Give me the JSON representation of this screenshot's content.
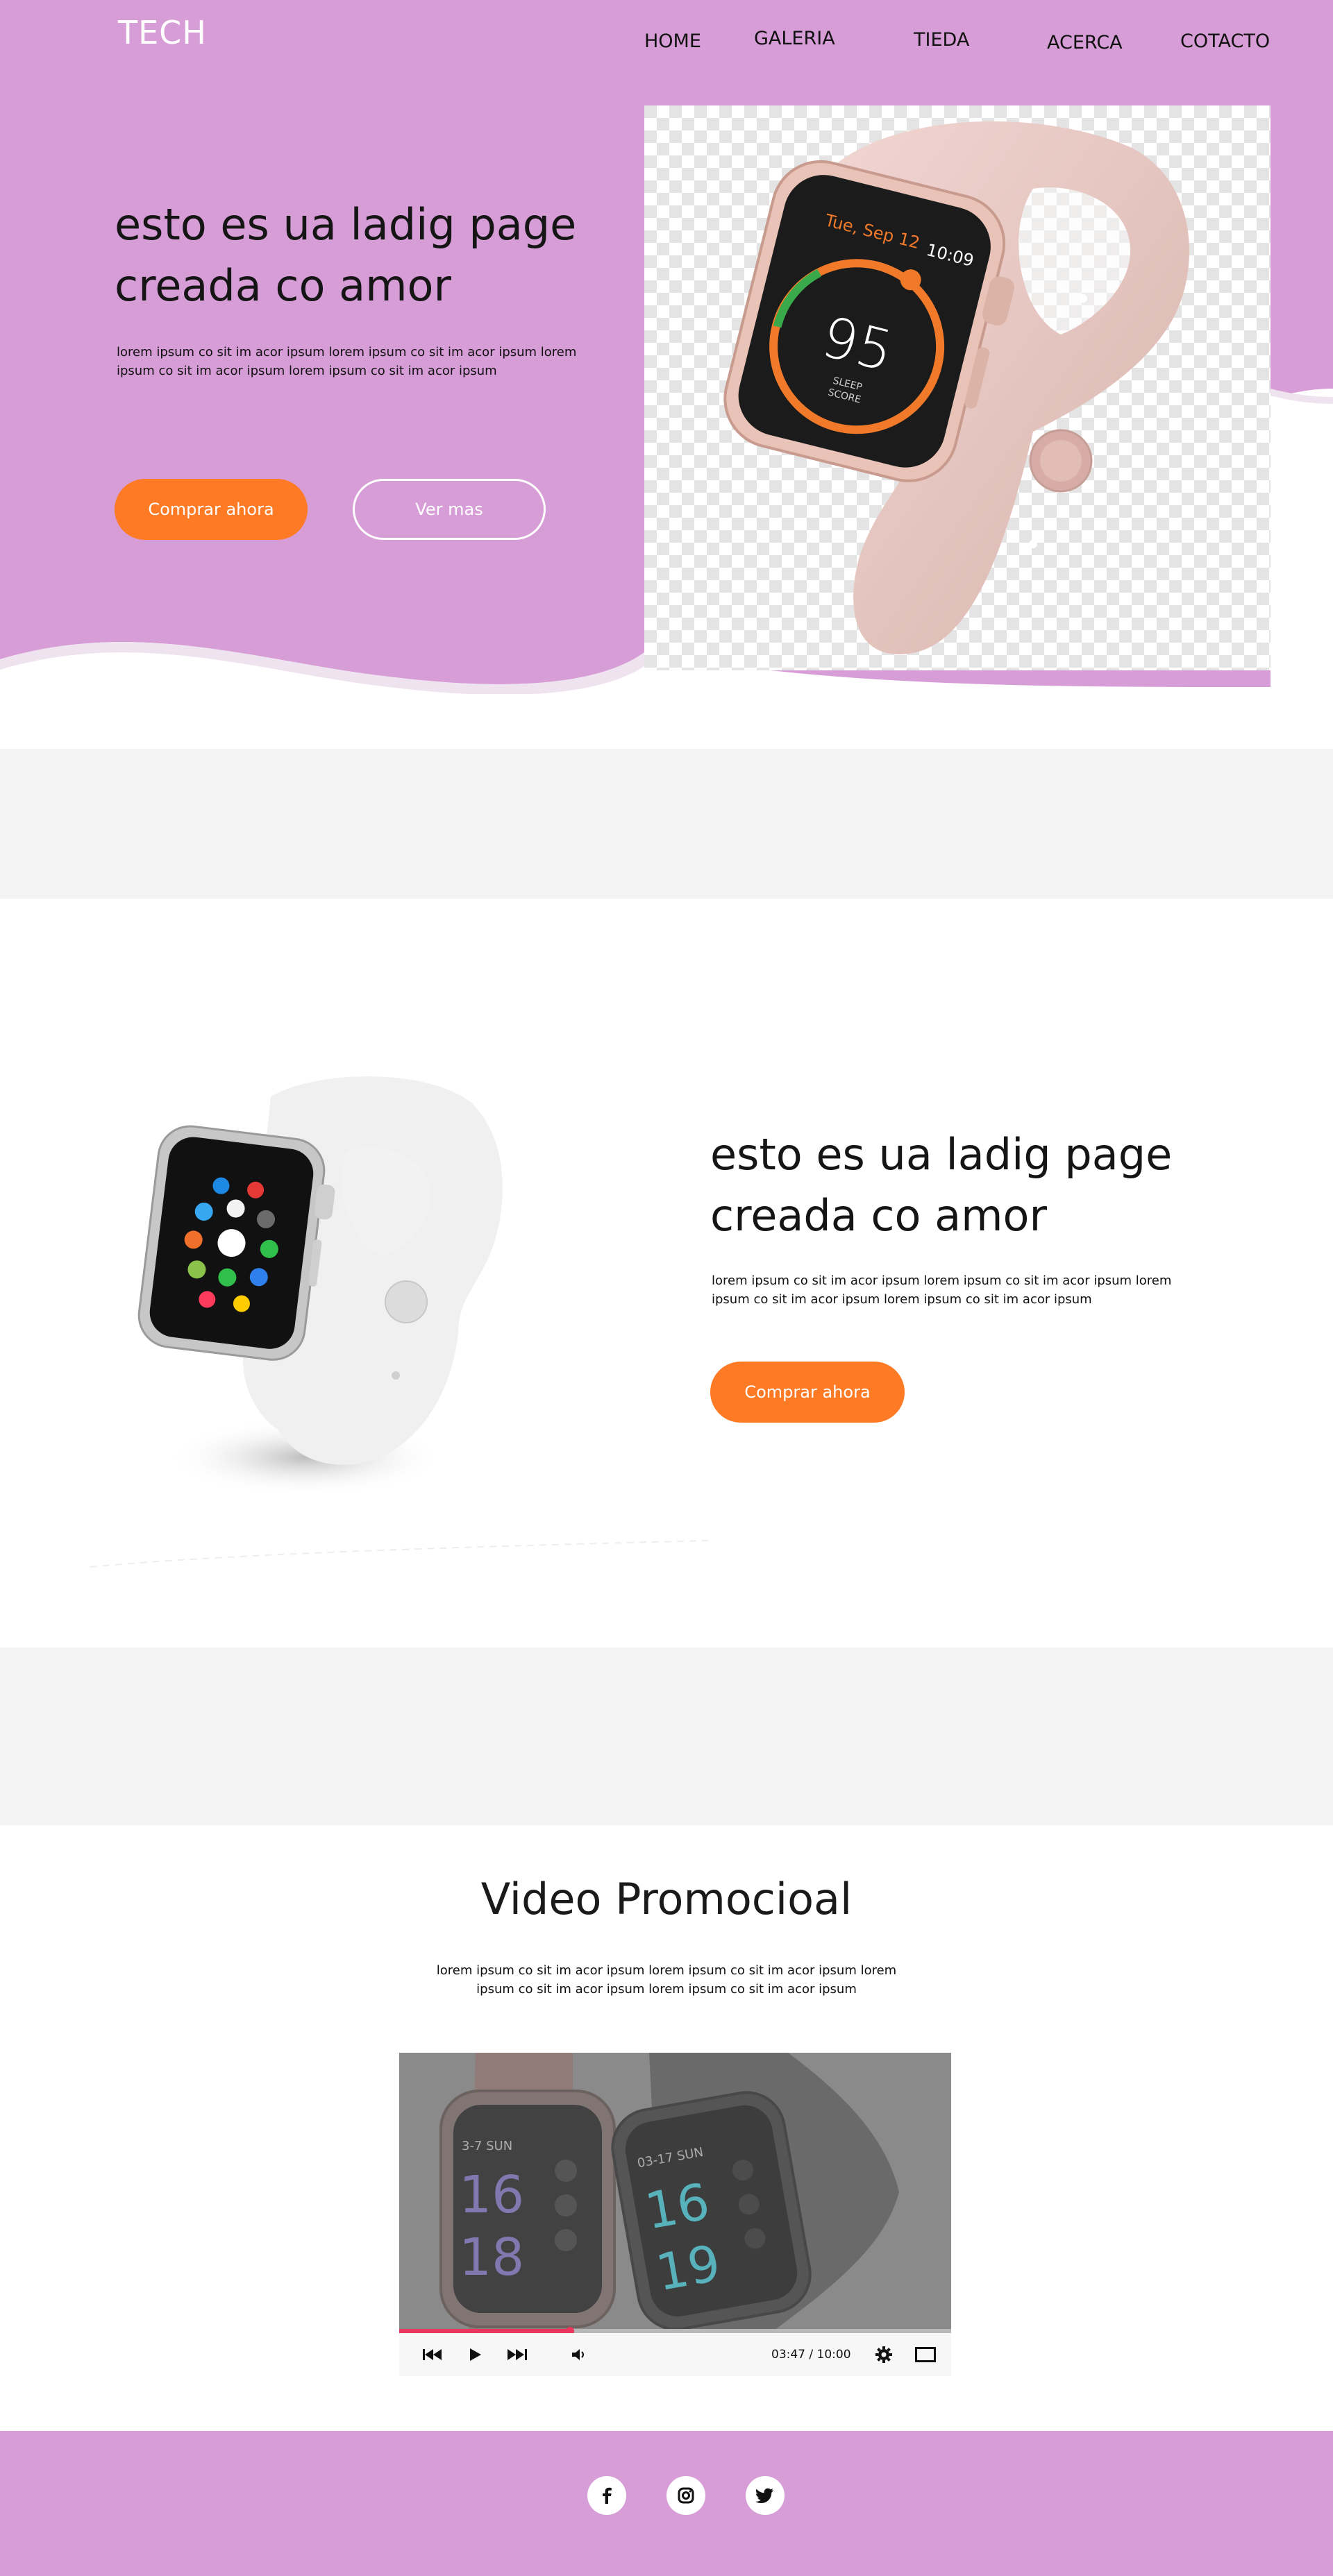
{
  "header": {
    "logo": "TECH",
    "nav": [
      "HOME",
      "GALERIA",
      "TIEDA",
      "ACERCA",
      "COTACTO"
    ]
  },
  "hero": {
    "title": "esto es ua ladig page creada co amor",
    "text": "lorem ipsum co sit im acor ipsum lorem ipsum co sit im acor ipsum lorem ipsum co sit im acor ipsum lorem ipsum co sit im acor ipsum",
    "buy_label": "Comprar ahora",
    "more_label": "Ver mas",
    "watch_date": "Tue, Sep 12",
    "watch_time": "10:09",
    "watch_score": "95",
    "watch_score_label_1": "SLEEP",
    "watch_score_label_2": "SCORE"
  },
  "product": {
    "title": "esto es ua ladig page creada co amor",
    "text": "lorem ipsum co sit im acor ipsum lorem ipsum co sit im acor ipsum lorem ipsum co sit im acor ipsum lorem ipsum co sit im acor ipsum",
    "buy_label": "Comprar ahora"
  },
  "video": {
    "title": "Video Promocioal",
    "text": "lorem ipsum co sit im acor ipsum lorem ipsum co sit im acor ipsum lorem ipsum co sit im acor ipsum lorem ipsum co sit im acor ipsum",
    "time": "03:47 / 10:00",
    "progress": 0.31,
    "watch1_top": "3-7 SUN",
    "watch1_big1": "16",
    "watch1_big2": "18",
    "watch2_top": "03-17 SUN",
    "watch2_big1": "16",
    "watch2_big2": "19"
  },
  "social": [
    "facebook-icon",
    "instagram-icon",
    "twitter-icon"
  ],
  "colors": {
    "brand_purple": "#d79dd7",
    "accent_orange": "#ff7a24",
    "band_gray": "#f3f3f3",
    "progress_red": "#e8365d"
  }
}
